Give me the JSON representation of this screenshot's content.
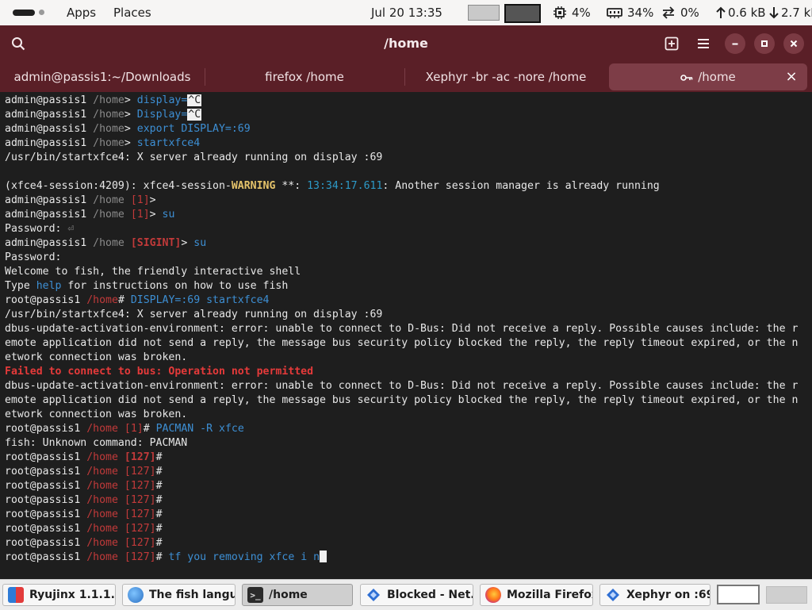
{
  "top_panel": {
    "apps_label": "Apps",
    "places_label": "Places",
    "datetime": "Jul 20  13:35",
    "cpu": "4%",
    "memory": "34%",
    "swap": "0%",
    "net_up": "0.6 kB",
    "net_down": "2.7 kB"
  },
  "window": {
    "title": "/home"
  },
  "tabs": [
    {
      "label": "admin@passis1:~/Downloads"
    },
    {
      "label": "firefox /home"
    },
    {
      "label": "Xephyr -br -ac -nore /home"
    },
    {
      "label": "/home",
      "close": "×"
    }
  ],
  "terminal": {
    "user": "admin@passis1",
    "root": "root@passis1",
    "dir": "/home",
    "l1_cmd": "display=",
    "l1_ctrl": "^C",
    "l2_cmd": "Display=",
    "l2_ctrl": "^C",
    "l3_cmd": "export DISPLAY=:69",
    "l4_cmd": "startxfce4",
    "l5": "/usr/bin/startxfce4: X server already running on display :69",
    "l7_a": "(xfce4-session:4209): xfce4-session-",
    "l7_warn": "WARNING",
    "l7_b": " **: ",
    "l7_time": "13:34:17.611",
    "l7_c": ": Another session manager is already running",
    "status_1": "[1]",
    "l9_cmd": "su",
    "password_label": "Password:",
    "password_glyph": "⏎",
    "status_sigint": "[SIGINT]",
    "l11_cmd": "su",
    "l13": "Welcome to fish, the friendly interactive shell",
    "l14_a": "Type ",
    "l14_help": "help",
    "l14_b": " for instructions on how to use fish",
    "l15_cmd": "DISPLAY=:69 startxfce4",
    "l16": "/usr/bin/startxfce4: X server already running on display :69",
    "dbus_1": "dbus-update-activation-environment: error: unable to connect to D-Bus: Did not receive a reply. Possible causes include: the r",
    "dbus_2": "emote application did not send a reply, the message bus security policy blocked the reply, the reply timeout expired, or the n",
    "dbus_3": "etwork connection was broken.",
    "fail_line": "Failed to connect to bus: Operation not permitted",
    "l24_cmd": "PACMAN -R xfce",
    "l25": "fish: Unknown command: PACMAN",
    "status_127": "[127]",
    "last_cmd": "tf you removing xfce i n"
  },
  "taskbar": [
    {
      "label": "Ryujinx 1.1.1...",
      "icon": "ryujinx-icon"
    },
    {
      "label": "The fish langu...",
      "icon": "globe-icon"
    },
    {
      "label": "/home",
      "icon": "terminal-icon"
    },
    {
      "label": "Blocked - Net...",
      "icon": "blue-diamond-icon"
    },
    {
      "label": "Mozilla Firefox",
      "icon": "firefox-icon"
    },
    {
      "label": "Xephyr on :69...",
      "icon": "blue-diamond-icon"
    }
  ]
}
